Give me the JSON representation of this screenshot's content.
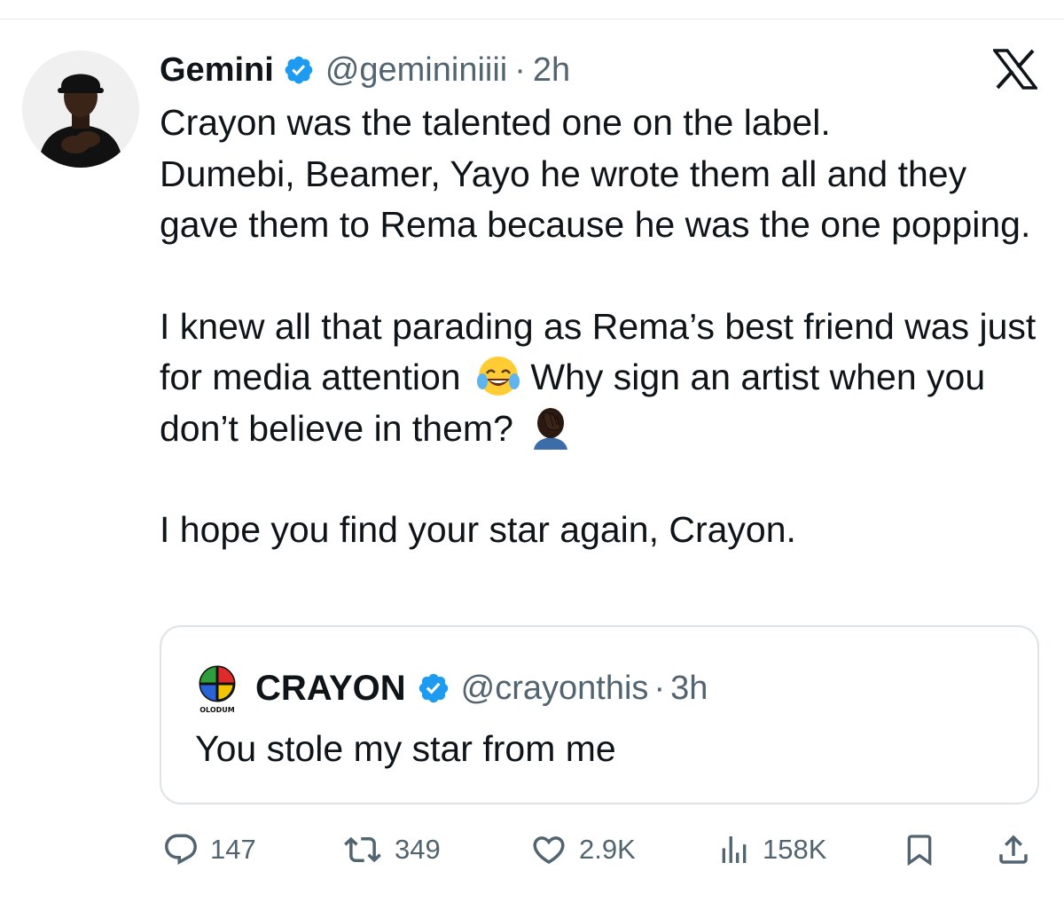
{
  "tweet": {
    "author_name": "Gemini",
    "handle": "@gemininiiii",
    "separator": "·",
    "time": "2h",
    "paragraphs": [
      "Crayon was the talented one on the label.\nDumebi, Beamer, Yayo he wrote them all and they gave them to Rema because he was the one popping.",
      "I knew all that parading as Rema’s best friend was just for media attention",
      "Why sign an artist when you don’t believe in them?",
      "I hope you find your star again, Crayon."
    ],
    "emojis": [
      "face-with-tears-of-joy-emoji",
      "person-facepalming-emoji"
    ]
  },
  "quote": {
    "author_name": "CRAYON",
    "avatar_text": "OLODUM",
    "handle": "@crayonthis",
    "separator": "·",
    "time": "3h",
    "text": "You stole my star from me"
  },
  "actions": {
    "replies": "147",
    "reposts": "349",
    "likes": "2.9K",
    "views": "158K"
  },
  "colors": {
    "verified": "#1d9bf0",
    "secondary_text": "#536471",
    "primary_text": "#0f1419"
  },
  "icons": [
    "x-logo-icon",
    "verified-badge-icon",
    "reply-icon",
    "repost-icon",
    "like-icon",
    "views-icon",
    "bookmark-icon",
    "share-icon"
  ]
}
